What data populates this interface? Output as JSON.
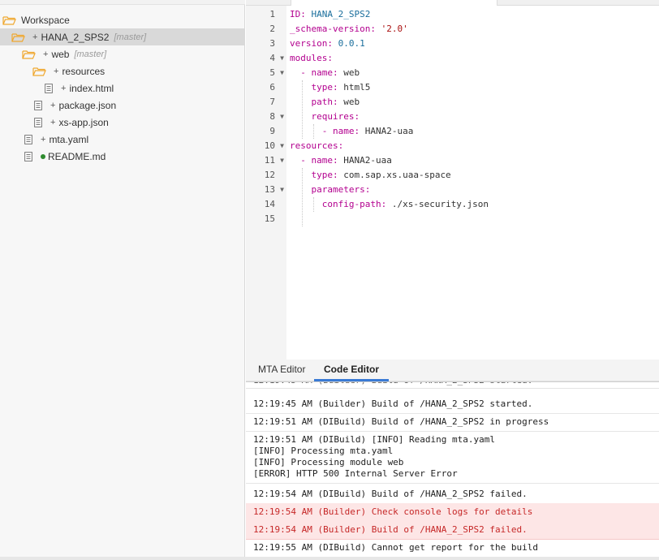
{
  "explorer": {
    "items": [
      {
        "label": "Workspace",
        "type": "folder",
        "toggle": "",
        "tag": ""
      },
      {
        "label": "HANA_2_SPS2",
        "type": "folder",
        "toggle": "+",
        "tag": "[master]"
      },
      {
        "label": "web",
        "type": "folder",
        "toggle": "+",
        "tag": "[master]"
      },
      {
        "label": "resources",
        "type": "folder",
        "toggle": "+",
        "tag": ""
      },
      {
        "label": "index.html",
        "type": "file",
        "toggle": "+",
        "tag": ""
      },
      {
        "label": "package.json",
        "type": "file",
        "toggle": "+",
        "tag": ""
      },
      {
        "label": "xs-app.json",
        "type": "file",
        "toggle": "+",
        "tag": ""
      },
      {
        "label": "mta.yaml",
        "type": "file",
        "toggle": "+",
        "tag": ""
      },
      {
        "label": "README.md",
        "type": "file",
        "toggle": "",
        "tag": ""
      }
    ]
  },
  "editor": {
    "line_numbers": [
      "1",
      "2",
      "3",
      "4",
      "5",
      "6",
      "7",
      "8",
      "9",
      "10",
      "11",
      "12",
      "13",
      "14",
      "15"
    ],
    "lines": [
      {
        "key": "ID:",
        "value": " HANA_2_SPS2"
      },
      {
        "key": "_schema-version:",
        "value": " '2.0'"
      },
      {
        "key": "version:",
        "value": " 0.0.1"
      },
      {
        "key": "modules:",
        "value": ""
      },
      {
        "key": "  - name:",
        "value": " web"
      },
      {
        "key": "    type:",
        "value": " html5"
      },
      {
        "key": "    path:",
        "value": " web"
      },
      {
        "key": "    requires:",
        "value": ""
      },
      {
        "key": "      - name:",
        "value": " HANA2-uaa"
      },
      {
        "key": "resources:",
        "value": ""
      },
      {
        "key": "  - name:",
        "value": " HANA2-uaa"
      },
      {
        "key": "    type:",
        "value": " com.sap.xs.uaa-space"
      },
      {
        "key": "    parameters:",
        "value": ""
      },
      {
        "key": "      config-path:",
        "value": " ./xs-security.json"
      },
      {
        "key": "",
        "value": ""
      }
    ]
  },
  "bottom_tabs": {
    "mta_editor": "MTA Editor",
    "code_editor": "Code Editor"
  },
  "console": {
    "entries": [
      {
        "text": "12:19:45 AM (Builder) Build of /HANA_2_SPS2 started.",
        "level": "info"
      },
      {
        "text": "12:19:51 AM (DIBuild) Build of /HANA_2_SPS2 in progress",
        "level": "info"
      },
      {
        "text": "12:19:51 AM (DIBuild) [INFO] Reading mta.yaml\n[INFO] Processing mta.yaml\n[INFO] Processing module web\n[ERROR] HTTP 500 Internal Server Error",
        "level": "info"
      },
      {
        "text": "12:19:54 AM (DIBuild) Build of /HANA_2_SPS2 failed.",
        "level": "info"
      },
      {
        "text": "12:19:54 AM (Builder) Check console logs for details",
        "level": "error"
      },
      {
        "text": "12:19:54 AM (Builder) Build of /HANA_2_SPS2 failed.",
        "level": "error"
      },
      {
        "text": "12:19:55 AM (DIBuild) Cannot get report for the build",
        "level": "info"
      }
    ]
  },
  "colors": {
    "accent": "#3a7bd5",
    "folder": "#f0a830",
    "error_bg": "#fde6e6",
    "error_text": "#c62828"
  }
}
